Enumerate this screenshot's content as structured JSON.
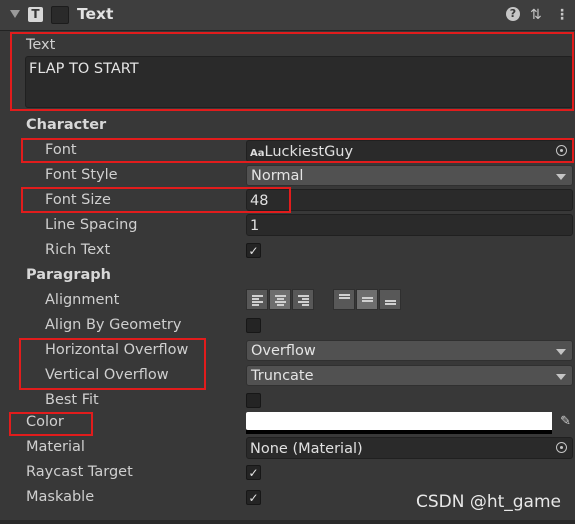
{
  "header": {
    "title": "Text",
    "type_glyph": "T",
    "help_icon": "question-icon",
    "preset_icon": "sliders-icon",
    "menu_icon": "kebab-icon"
  },
  "text": {
    "label": "Text",
    "value": "FLAP TO START"
  },
  "character": {
    "section": "Character",
    "font": {
      "label": "Font",
      "prefix": "Aa",
      "value": "LuckiestGuy"
    },
    "font_style": {
      "label": "Font Style",
      "value": "Normal"
    },
    "font_size": {
      "label": "Font Size",
      "value": "48"
    },
    "line_spacing": {
      "label": "Line Spacing",
      "value": "1"
    },
    "rich_text": {
      "label": "Rich Text",
      "checked": true,
      "check": "✓"
    }
  },
  "paragraph": {
    "section": "Paragraph",
    "alignment": {
      "label": "Alignment"
    },
    "align_by_geometry": {
      "label": "Align By Geometry",
      "checked": false
    },
    "horizontal_overflow": {
      "label": "Horizontal Overflow",
      "value": "Overflow"
    },
    "vertical_overflow": {
      "label": "Vertical Overflow",
      "value": "Truncate"
    },
    "best_fit": {
      "label": "Best Fit",
      "checked": false
    }
  },
  "color": {
    "label": "Color",
    "value": "#FFFFFF"
  },
  "material": {
    "label": "Material",
    "value": "None (Material)"
  },
  "raycast_target": {
    "label": "Raycast Target",
    "checked": true,
    "check": "✓"
  },
  "maskable": {
    "label": "Maskable",
    "checked": true,
    "check": "✓"
  },
  "watermark": "CSDN @ht_game",
  "highlight_color": "#E11C1C"
}
